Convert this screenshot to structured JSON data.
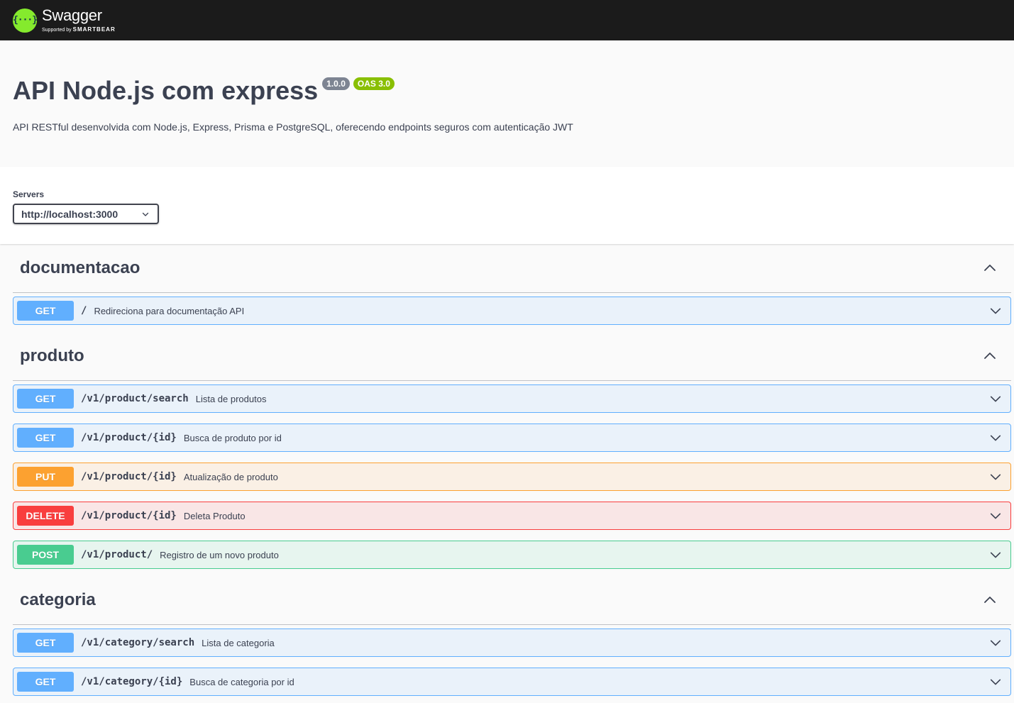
{
  "topbar": {
    "logo_name": "Swagger",
    "logo_sub_prefix": "Supported by",
    "logo_sub_brand": "SMARTBEAR",
    "logo_glyph": "{···}"
  },
  "info": {
    "title": "API Node.js com express",
    "version": "1.0.0",
    "oas": "OAS 3.0",
    "description": "API RESTful desenvolvida com Node.js, Express, Prisma e PostgreSQL, oferecendo endpoints seguros com autenticação JWT"
  },
  "servers": {
    "label": "Servers",
    "selected": "http://localhost:3000"
  },
  "tags": [
    {
      "name": "documentacao",
      "operations": [
        {
          "method": "GET",
          "path": "/",
          "summary": "Redireciona para documentação API"
        }
      ]
    },
    {
      "name": "produto",
      "operations": [
        {
          "method": "GET",
          "path": "/v1/product/search",
          "summary": "Lista de produtos"
        },
        {
          "method": "GET",
          "path": "/v1/product/{id}",
          "summary": "Busca de produto por id"
        },
        {
          "method": "PUT",
          "path": "/v1/product/{id}",
          "summary": "Atualização de produto"
        },
        {
          "method": "DELETE",
          "path": "/v1/product/{id}",
          "summary": "Deleta Produto"
        },
        {
          "method": "POST",
          "path": "/v1/product/",
          "summary": "Registro de um novo produto"
        }
      ]
    },
    {
      "name": "categoria",
      "operations": [
        {
          "method": "GET",
          "path": "/v1/category/search",
          "summary": "Lista de categoria"
        },
        {
          "method": "GET",
          "path": "/v1/category/{id}",
          "summary": "Busca de categoria por id"
        }
      ]
    }
  ],
  "colors": {
    "topbar": "#1b1b1b",
    "logo": "#85ea2d",
    "get": "#61affe",
    "put": "#fca130",
    "delete": "#f93e3e",
    "post": "#49cc90",
    "version_badge": "#7d8492",
    "oas_badge": "#89bf04"
  },
  "icons": {
    "tag_toggle": "chevron-up-icon",
    "op_toggle": "chevron-down-icon",
    "server_select": "chevron-down-icon"
  }
}
